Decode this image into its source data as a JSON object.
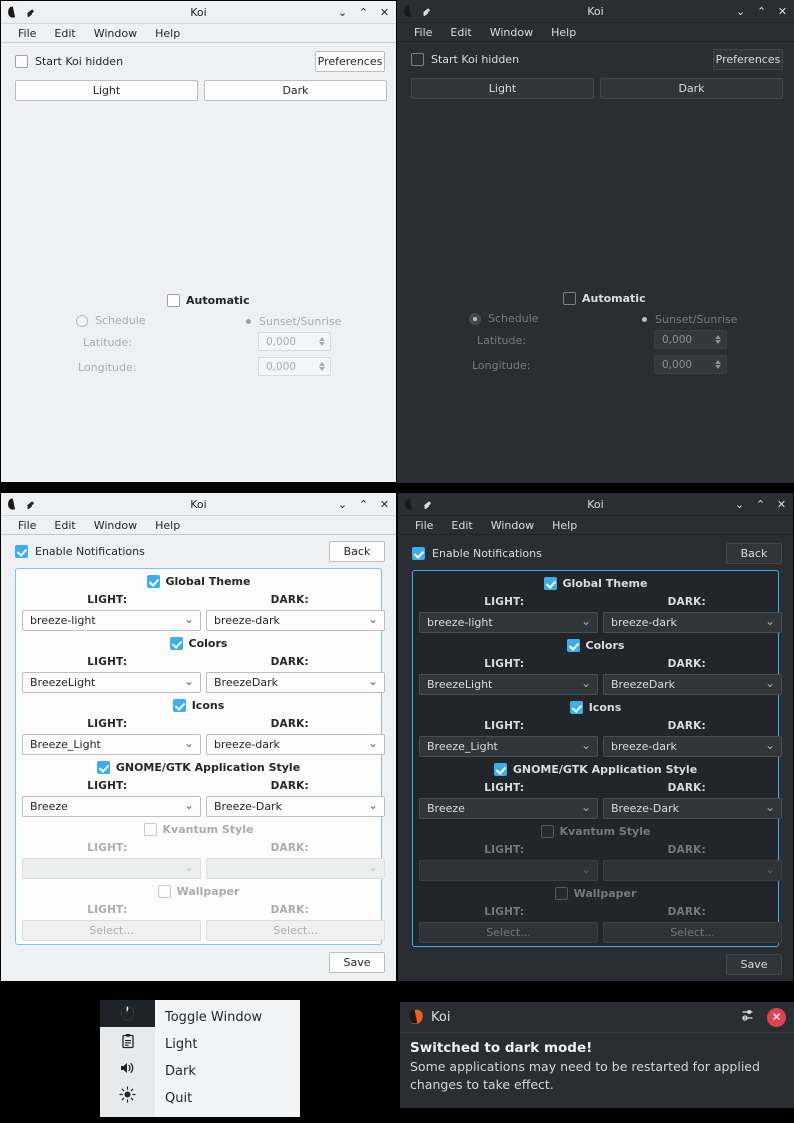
{
  "app": {
    "title": "Koi",
    "icon": "koi-fish-icon",
    "pin_icon": "pin-icon"
  },
  "menubar": {
    "items": [
      "File",
      "Edit",
      "Window",
      "Help"
    ]
  },
  "window_controls": {
    "minimize": "⌄",
    "maximize": "⌃",
    "close": "✕"
  },
  "main_window": {
    "start_hidden_label": "Start Koi hidden",
    "start_hidden_checked": false,
    "preferences_label": "Preferences",
    "light_button": "Light",
    "dark_button": "Dark",
    "automatic_label": "Automatic",
    "automatic_checked": false,
    "schedule_label": "Schedule",
    "schedule_selected": false,
    "sunset_label": "Sunset/Sunrise",
    "sunset_selected": true,
    "latitude_label": "Latitude:",
    "latitude_value": "0,000",
    "longitude_label": "Longitude:",
    "longitude_value": "0,000"
  },
  "preferences_window": {
    "enable_notifications_label": "Enable Notifications",
    "enable_notifications_checked": true,
    "back_label": "Back",
    "save_label": "Save",
    "light_header": "LIGHT:",
    "dark_header": "DARK:",
    "sections": [
      {
        "name": "Global Theme",
        "checked": true,
        "enabled": true,
        "light_value": "breeze-light",
        "dark_value": "breeze-dark"
      },
      {
        "name": "Colors",
        "checked": true,
        "enabled": true,
        "light_value": "BreezeLight",
        "dark_value": "BreezeDark"
      },
      {
        "name": "Icons",
        "checked": true,
        "enabled": true,
        "light_value": "Breeze_Light",
        "dark_value": "breeze-dark"
      },
      {
        "name": "GNOME/GTK Application Style",
        "checked": true,
        "enabled": true,
        "light_value": "Breeze",
        "dark_value": "Breeze-Dark"
      },
      {
        "name": "Kvantum Style",
        "checked": false,
        "enabled": false,
        "light_value": "",
        "dark_value": ""
      },
      {
        "name": "Wallpaper",
        "checked": false,
        "enabled": false,
        "light_value": "Select...",
        "dark_value": "Select...",
        "is_button": true
      }
    ]
  },
  "tray_menu": {
    "icons": [
      "koi-tray-icon",
      "clipboard-icon",
      "speaker-icon",
      "brightness-icon"
    ],
    "items": [
      "Toggle Window",
      "Light",
      "Dark",
      "Quit"
    ]
  },
  "notification": {
    "app_name": "Koi",
    "icon": "koi-fish-icon",
    "settings_icon": "sliders-icon",
    "close_icon": "close-icon",
    "close_glyph": "✕",
    "heading": "Switched to dark mode!",
    "message": "Some applications may need to be restarted for applied changes to take effect."
  },
  "colors": {
    "light_bg": "#eff0f1",
    "dark_bg": "#2a2e32",
    "accent": "#3daee9",
    "brand_orange": "#e8641c",
    "close_red": "#da4453"
  }
}
